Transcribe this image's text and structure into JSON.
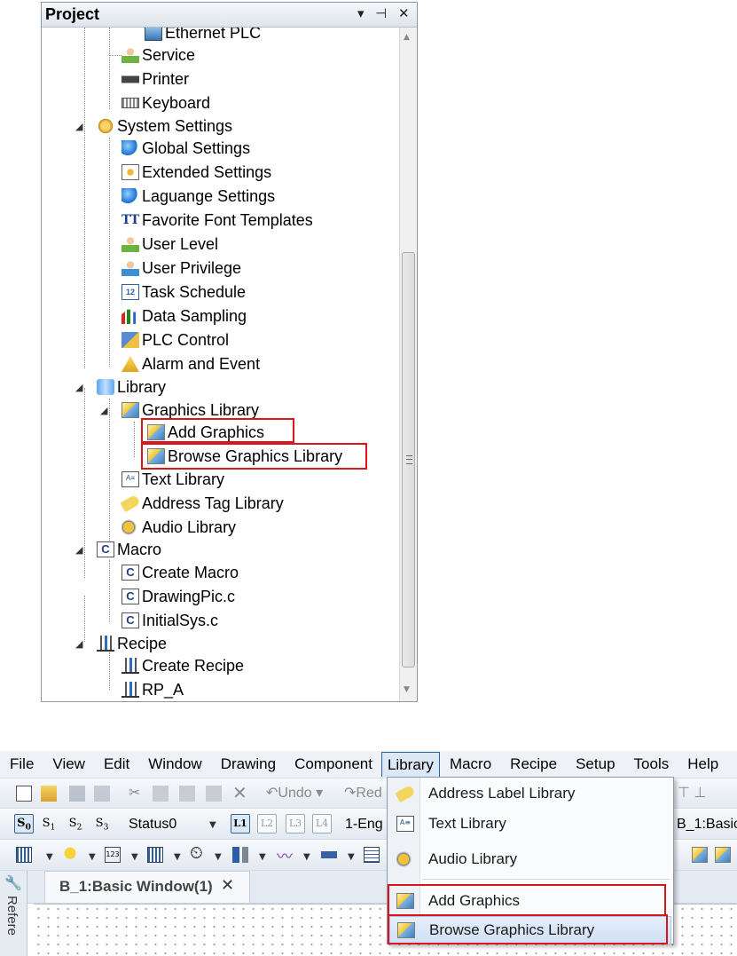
{
  "project_panel": {
    "title": "Project",
    "header_buttons": [
      "▾",
      "⊣",
      "✕"
    ],
    "tree": [
      {
        "label": "Ethernet PLC",
        "icon": "network-icon"
      },
      {
        "label": "Service",
        "icon": "users-icon"
      },
      {
        "label": "Printer",
        "icon": "printer-icon"
      },
      {
        "label": "Keyboard",
        "icon": "keyboard-icon"
      },
      {
        "label": "System Settings",
        "icon": "gear-icon"
      },
      {
        "label": "Global Settings",
        "icon": "globe-icon"
      },
      {
        "label": "Extended Settings",
        "icon": "extended-settings-icon"
      },
      {
        "label": "Laguange Settings",
        "icon": "language-globe-icon"
      },
      {
        "label": "Favorite Font Templates",
        "icon": "font-icon",
        "glyph": "TT"
      },
      {
        "label": "User Level",
        "icon": "user-level-icon"
      },
      {
        "label": "User Privilege",
        "icon": "user-privilege-icon"
      },
      {
        "label": "Task Schedule",
        "icon": "calendar-icon",
        "glyph": "12"
      },
      {
        "label": "Data Sampling",
        "icon": "bar-chart-icon"
      },
      {
        "label": "PLC Control",
        "icon": "plc-control-icon"
      },
      {
        "label": "Alarm and Event",
        "icon": "alarm-icon"
      },
      {
        "label": "Library",
        "icon": "database-icon"
      },
      {
        "label": "Graphics Library",
        "icon": "graphics-icon"
      },
      {
        "label": "Add Graphics",
        "icon": "add-graphics-icon"
      },
      {
        "label": "Browse Graphics Library",
        "icon": "browse-graphics-icon"
      },
      {
        "label": "Text Library",
        "icon": "text-library-icon"
      },
      {
        "label": "Address Tag Library",
        "icon": "tag-icon"
      },
      {
        "label": "Audio Library",
        "icon": "audio-icon"
      },
      {
        "label": "Macro",
        "icon": "macro-file-icon",
        "glyph": "C"
      },
      {
        "label": "Create Macro",
        "icon": "create-macro-icon",
        "glyph": "C"
      },
      {
        "label": "DrawingPic.c",
        "icon": "c-file-icon",
        "glyph": "C"
      },
      {
        "label": "InitialSys.c",
        "icon": "c-file-icon",
        "glyph": "C"
      },
      {
        "label": "Recipe",
        "icon": "recipe-icon"
      },
      {
        "label": "Create Recipe",
        "icon": "create-recipe-icon"
      },
      {
        "label": "RP_A",
        "icon": "recipe-icon"
      }
    ]
  },
  "menubar": {
    "items": [
      "File",
      "View",
      "Edit",
      "Window",
      "Drawing",
      "Component",
      "Library",
      "Macro",
      "Recipe",
      "Setup",
      "Tools",
      "Help"
    ],
    "active": "Library"
  },
  "toolbar1": {
    "undo_label": "Undo",
    "redo_label": "Red"
  },
  "toolbar2": {
    "state_buttons": [
      "S0",
      "S1",
      "S2",
      "S3"
    ],
    "state_combo": "Status0",
    "layer_buttons": [
      "L1",
      "L2",
      "L3",
      "L4"
    ],
    "language_combo": "1-Eng",
    "window_combo": "B_1:Basic"
  },
  "document": {
    "tab_label": "B_1:Basic Window(1)",
    "tab_close": "✕",
    "side_panel_label": "Refere"
  },
  "library_menu": {
    "items": [
      {
        "label": "Address Label Library",
        "icon": "tag-icon"
      },
      {
        "label": "Text Library",
        "icon": "text-library-icon"
      },
      {
        "label": "Audio Library",
        "icon": "audio-icon"
      },
      {
        "label": "Add Graphics",
        "icon": "add-graphics-icon"
      },
      {
        "label": "Browse Graphics Library",
        "icon": "browse-graphics-icon"
      }
    ]
  },
  "highlight_color": "#d8151b"
}
